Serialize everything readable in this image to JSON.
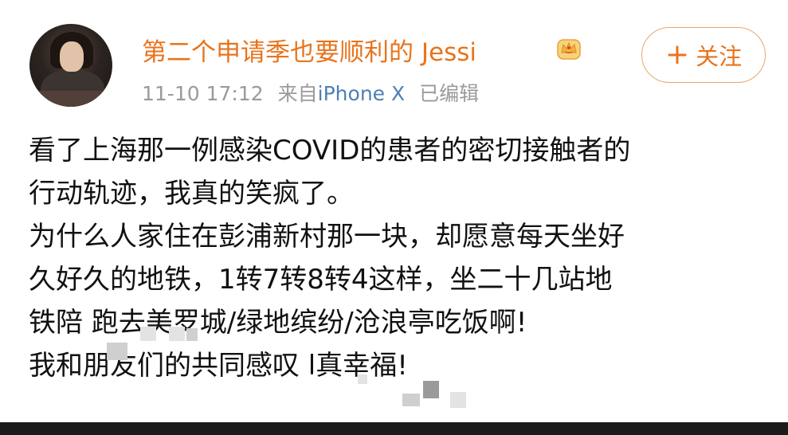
{
  "post": {
    "username": "第二个申请季也要顺利的 Jessi",
    "time": "11-10 17:12",
    "source_prefix": "来自",
    "device": "iPhone X",
    "edited": "已编辑",
    "follow_label": "关注",
    "follow_plus": "+",
    "lines": [
      "看了上海那一例感染COVID的患者的密切接触者的",
      "行动轨迹，我真的笑疯了。",
      "为什么人家住在彭浦新村那一块，却愿意每天坐好",
      "久好久的地铁，1转7转8转4这样，坐二十几站地",
      "铁陪         跑去美罗城/绿地缤纷/沧浪亭吃饭啊!",
      "我和朋友们的共同感叹               l真幸福!"
    ]
  },
  "icons": {
    "avatar": "avatar",
    "crown": "crown-badge-icon"
  },
  "colors": {
    "username": "#e8741c",
    "device": "#4f7fb5",
    "meta": "#9a9a9a",
    "button_border": "#e8a66a"
  }
}
